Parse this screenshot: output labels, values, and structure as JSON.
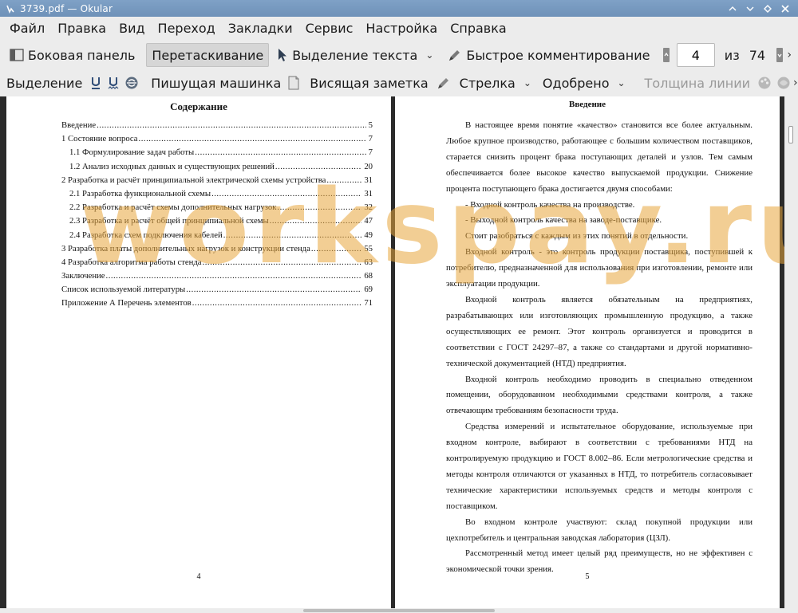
{
  "window": {
    "title": "3739.pdf  — Okular"
  },
  "menu": {
    "items": [
      "Файл",
      "Правка",
      "Вид",
      "Переход",
      "Закладки",
      "Сервис",
      "Настройка",
      "Справка"
    ]
  },
  "toolbar1": {
    "sidebar_label": "Боковая панель",
    "drag_label": "Перетаскивание",
    "text_select_label": "Выделение текста",
    "quick_comment_label": "Быстрое комментирование",
    "page_value": "4",
    "page_of": "из",
    "page_total": "74"
  },
  "toolbar2": {
    "highlight_label": "Выделение",
    "typewriter_label": "Пишущая машинка",
    "sticky_note_label": "Висящая заметка",
    "arrow_label": "Стрелка",
    "stamp_label": "Одобрено",
    "line_width_label": "Толщина линии"
  },
  "page_left": {
    "title": "Содержание",
    "toc": [
      {
        "label": "Введение",
        "page": "5",
        "indent": false
      },
      {
        "label": "1 Состояние вопроса",
        "page": "7",
        "indent": false
      },
      {
        "label": "1.1 Формулирование задач работы",
        "page": "7",
        "indent": true
      },
      {
        "label": "1.2 Анализ исходных данных и существующих решений",
        "page": "20",
        "indent": true
      },
      {
        "label": "2 Разработка и расчёт принципиальной электрической схемы устройства",
        "page": "31",
        "indent": false
      },
      {
        "label": "2.1 Разработка функциональной схемы",
        "page": "31",
        "indent": true
      },
      {
        "label": "2.2 Разработка и расчёт схемы дополнительных нагрузок",
        "page": "32",
        "indent": true
      },
      {
        "label": "2.3 Разработка и расчёт общей принципиальной схемы",
        "page": "47",
        "indent": true
      },
      {
        "label": "2.4 Разработка схем подключения кабелей",
        "page": "49",
        "indent": true
      },
      {
        "label": "3 Разработка платы дополнительных нагрузок и конструкции стенда",
        "page": "55",
        "indent": false
      },
      {
        "label": "4 Разработка алгоритма работы стенда",
        "page": "63",
        "indent": false
      },
      {
        "label": "Заключение",
        "page": "68",
        "indent": false
      },
      {
        "label": "Список используемой литературы",
        "page": "69",
        "indent": false
      },
      {
        "label": "Приложение А  Перечень элементов",
        "page": "71",
        "indent": false
      }
    ],
    "page_number": "4"
  },
  "page_right": {
    "title": "Введение",
    "paragraphs": [
      {
        "text": "В настоящее время понятие «качество» становится все более актуальным. Любое крупное производство, работающее с большим количеством поставщиков, старается снизить процент брака поступающих деталей и узлов. Тем самым обеспечивается более высокое качество выпускаемой продукции. Снижение процента поступающего брака достигается двумя способами:",
        "indent": true
      },
      {
        "text": "- Входной контроль качества на производстве.",
        "indent": true
      },
      {
        "text": "- Выходной контроль качества на заводе-поставщике.",
        "indent": true
      },
      {
        "text": "Стоит разобраться с каждым из этих понятий в отдельности.",
        "indent": true
      },
      {
        "text": "Входной контроль - это контроль продукции поставщика, поступившей к потребителю, предназначенной для использования при изготовлении, ремонте или эксплуатации продукции.",
        "indent": true
      },
      {
        "text": "Входной контроль является обязательным на предприятиях, разрабатывающих или изготовляющих промышленную продукцию, а также осуществляющих ее ремонт. Этот контроль организуется и проводится в соответствии с ГОСТ 24297–87, а также со стандартами и другой нормативно-технической документацией (НТД) предприятия.",
        "indent": true
      },
      {
        "text": "Входной контроль необходимо проводить в специально отведенном помещении, оборудованном необходимыми средствами контроля, а также отвечающим требованиям безопасности труда.",
        "indent": true
      },
      {
        "text": "Средства измерений и испытательное оборудование, используемые при входном контроле, выбирают в соответствии с требованиями НТД на контролируемую продукцию и ГОСТ 8.002–86. Если метрологические средства и методы контроля отличаются от указанных в НТД, то потребитель согласовывает технические характеристики используемых средств и методы контроля с поставщиком.",
        "indent": true
      },
      {
        "text": "Во входном контроле участвуют: склад покупной продукции или цехпотребитель и центральная заводская лаборатория (ЦЗЛ).",
        "indent": true
      },
      {
        "text": "Рассмотренный метод имеет целый ряд преимуществ, но не эффективен с экономической точки зрения.",
        "indent": true
      }
    ],
    "page_number": "5"
  },
  "watermark": {
    "text": "workspay.ru"
  },
  "colors": {
    "titlebar": "#7fa1c6",
    "toolbar_bg": "#ececec",
    "viewer_bg": "#2b2b2b",
    "watermark": "#e8a63c"
  }
}
